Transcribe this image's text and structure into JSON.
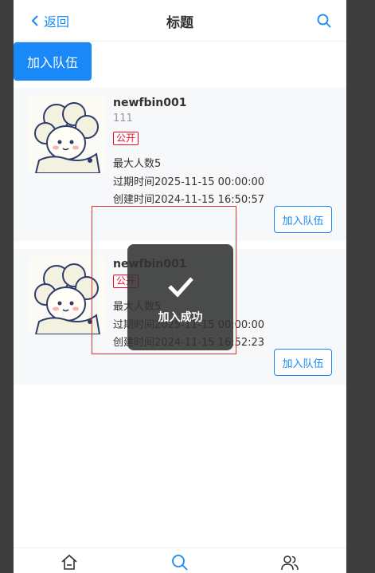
{
  "navbar": {
    "back_label": "返回",
    "title": "标题"
  },
  "actions": {
    "join_team_label": "加入队伍"
  },
  "teams": [
    {
      "name": "newfbin001",
      "description": "111",
      "status": "公开",
      "max_members": "最大人数5",
      "expire_time": "过期时间2025-11-15 00:00:00",
      "create_time": "创建时间2024-11-15 16:50:57",
      "join_label": "加入队伍"
    },
    {
      "name": "newfbin001",
      "description": "",
      "status": "公开",
      "max_members": "最大人数5",
      "expire_time": "过期时间2025-11-15 00:00:00",
      "create_time": "创建时间2024-11-15 16:52:23",
      "join_label": "加入队伍"
    }
  ],
  "toast": {
    "message": "加入成功",
    "icon": "checkmark-icon"
  },
  "tabbar": {
    "items": [
      "home-icon",
      "search-icon",
      "users-icon"
    ]
  },
  "colors": {
    "primary": "#1989fa",
    "tag_red": "#ee0a24",
    "card_bg": "#f7f8fa",
    "toast_bg": "#323232"
  }
}
